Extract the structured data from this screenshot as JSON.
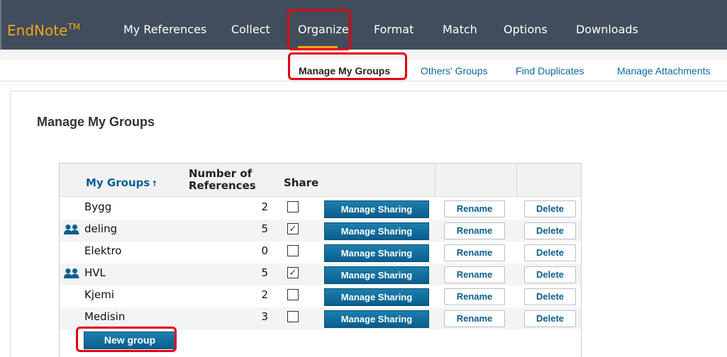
{
  "brand": {
    "name": "EndNote",
    "mark": "TM"
  },
  "nav": [
    "My References",
    "Collect",
    "Organize",
    "Format",
    "Match",
    "Options",
    "Downloads"
  ],
  "subnav": [
    "Manage My Groups",
    "Others' Groups",
    "Find Duplicates",
    "Manage Attachments"
  ],
  "page_title": "Manage My Groups",
  "table": {
    "headers": {
      "groups": "My Groups",
      "sort_glyph": "↑",
      "count_line1": "Number of",
      "count_line2": "References",
      "share": "Share"
    },
    "rows": [
      {
        "name": "Bygg",
        "count": "2",
        "shared": false,
        "shared_icon": false
      },
      {
        "name": "deling",
        "count": "5",
        "shared": true,
        "shared_icon": true
      },
      {
        "name": "Elektro",
        "count": "0",
        "shared": false,
        "shared_icon": false
      },
      {
        "name": "HVL",
        "count": "5",
        "shared": true,
        "shared_icon": true
      },
      {
        "name": "Kjemi",
        "count": "2",
        "shared": false,
        "shared_icon": false
      },
      {
        "name": "Medisin",
        "count": "3",
        "shared": false,
        "shared_icon": false
      }
    ],
    "manage_sharing_label": "Manage Sharing",
    "rename_label": "Rename",
    "delete_label": "Delete",
    "checked_glyph": "✓"
  },
  "new_group_label": "New group",
  "colors": {
    "topbar": "#414d5c",
    "brand": "#f6a21b",
    "highlight": "#e3000f",
    "button": "#0a5e8d",
    "link": "#0a6aa1"
  },
  "icons": {
    "shared_group": "people-icon",
    "sort": "sort-arrow-up-icon"
  }
}
